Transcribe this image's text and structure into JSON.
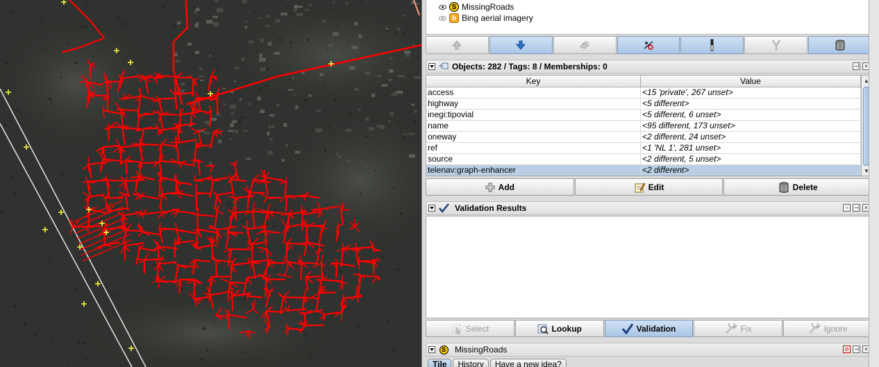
{
  "layers": [
    {
      "name": "MissingRoads",
      "icon": "missing-roads-icon",
      "visible": true
    },
    {
      "name": "Bing aerial imagery",
      "icon": "bing-icon",
      "visible": true
    }
  ],
  "toolbar": {
    "buttons": [
      "move-up-icon",
      "move-down-icon",
      "activate-icon",
      "visibility-icon",
      "opacity-icon",
      "merge-icon",
      "delete-icon"
    ]
  },
  "tags_panel": {
    "title": "Objects: 282 / Tags: 8 / Memberships: 0",
    "columns": {
      "key": "Key",
      "value": "Value"
    },
    "rows": [
      {
        "key": "access",
        "value": "<15 'private', 267 unset>"
      },
      {
        "key": "highway",
        "value": "<5 different>"
      },
      {
        "key": "inegi:tipovial",
        "value": "<5 different, 6 unset>"
      },
      {
        "key": "name",
        "value": "<95 different, 173 unset>"
      },
      {
        "key": "oneway",
        "value": "<2 different, 24 unset>"
      },
      {
        "key": "ref",
        "value": "<1 'NL 1', 281 unset>"
      },
      {
        "key": "source",
        "value": "<2 different, 5 unset>"
      },
      {
        "key": "telenav:graph-enhancer",
        "value": "<2 different>"
      }
    ],
    "buttons": {
      "add": "Add",
      "edit": "Edit",
      "delete": "Delete"
    }
  },
  "validation_panel": {
    "title": "Validation Results",
    "buttons": {
      "select": "Select",
      "lookup": "Lookup",
      "validation": "Validation",
      "fix": "Fix",
      "ignore": "Ignore"
    }
  },
  "missing_roads_panel": {
    "title": "MissingRoads",
    "tabs": [
      "Tile",
      "History",
      "Have a new idea?"
    ]
  },
  "colors": {
    "accent_red": "#ff0000",
    "selection": "#b8cfe5"
  }
}
